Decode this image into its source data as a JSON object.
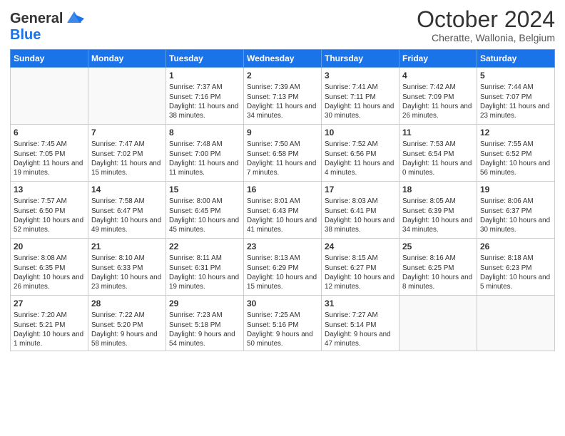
{
  "logo": {
    "line1": "General",
    "line2": "Blue"
  },
  "title": "October 2024",
  "subtitle": "Cheratte, Wallonia, Belgium",
  "weekdays": [
    "Sunday",
    "Monday",
    "Tuesday",
    "Wednesday",
    "Thursday",
    "Friday",
    "Saturday"
  ],
  "weeks": [
    [
      {
        "day": "",
        "info": ""
      },
      {
        "day": "",
        "info": ""
      },
      {
        "day": "1",
        "info": "Sunrise: 7:37 AM\nSunset: 7:16 PM\nDaylight: 11 hours and 38 minutes."
      },
      {
        "day": "2",
        "info": "Sunrise: 7:39 AM\nSunset: 7:13 PM\nDaylight: 11 hours and 34 minutes."
      },
      {
        "day": "3",
        "info": "Sunrise: 7:41 AM\nSunset: 7:11 PM\nDaylight: 11 hours and 30 minutes."
      },
      {
        "day": "4",
        "info": "Sunrise: 7:42 AM\nSunset: 7:09 PM\nDaylight: 11 hours and 26 minutes."
      },
      {
        "day": "5",
        "info": "Sunrise: 7:44 AM\nSunset: 7:07 PM\nDaylight: 11 hours and 23 minutes."
      }
    ],
    [
      {
        "day": "6",
        "info": "Sunrise: 7:45 AM\nSunset: 7:05 PM\nDaylight: 11 hours and 19 minutes."
      },
      {
        "day": "7",
        "info": "Sunrise: 7:47 AM\nSunset: 7:02 PM\nDaylight: 11 hours and 15 minutes."
      },
      {
        "day": "8",
        "info": "Sunrise: 7:48 AM\nSunset: 7:00 PM\nDaylight: 11 hours and 11 minutes."
      },
      {
        "day": "9",
        "info": "Sunrise: 7:50 AM\nSunset: 6:58 PM\nDaylight: 11 hours and 7 minutes."
      },
      {
        "day": "10",
        "info": "Sunrise: 7:52 AM\nSunset: 6:56 PM\nDaylight: 11 hours and 4 minutes."
      },
      {
        "day": "11",
        "info": "Sunrise: 7:53 AM\nSunset: 6:54 PM\nDaylight: 11 hours and 0 minutes."
      },
      {
        "day": "12",
        "info": "Sunrise: 7:55 AM\nSunset: 6:52 PM\nDaylight: 10 hours and 56 minutes."
      }
    ],
    [
      {
        "day": "13",
        "info": "Sunrise: 7:57 AM\nSunset: 6:50 PM\nDaylight: 10 hours and 52 minutes."
      },
      {
        "day": "14",
        "info": "Sunrise: 7:58 AM\nSunset: 6:47 PM\nDaylight: 10 hours and 49 minutes."
      },
      {
        "day": "15",
        "info": "Sunrise: 8:00 AM\nSunset: 6:45 PM\nDaylight: 10 hours and 45 minutes."
      },
      {
        "day": "16",
        "info": "Sunrise: 8:01 AM\nSunset: 6:43 PM\nDaylight: 10 hours and 41 minutes."
      },
      {
        "day": "17",
        "info": "Sunrise: 8:03 AM\nSunset: 6:41 PM\nDaylight: 10 hours and 38 minutes."
      },
      {
        "day": "18",
        "info": "Sunrise: 8:05 AM\nSunset: 6:39 PM\nDaylight: 10 hours and 34 minutes."
      },
      {
        "day": "19",
        "info": "Sunrise: 8:06 AM\nSunset: 6:37 PM\nDaylight: 10 hours and 30 minutes."
      }
    ],
    [
      {
        "day": "20",
        "info": "Sunrise: 8:08 AM\nSunset: 6:35 PM\nDaylight: 10 hours and 26 minutes."
      },
      {
        "day": "21",
        "info": "Sunrise: 8:10 AM\nSunset: 6:33 PM\nDaylight: 10 hours and 23 minutes."
      },
      {
        "day": "22",
        "info": "Sunrise: 8:11 AM\nSunset: 6:31 PM\nDaylight: 10 hours and 19 minutes."
      },
      {
        "day": "23",
        "info": "Sunrise: 8:13 AM\nSunset: 6:29 PM\nDaylight: 10 hours and 15 minutes."
      },
      {
        "day": "24",
        "info": "Sunrise: 8:15 AM\nSunset: 6:27 PM\nDaylight: 10 hours and 12 minutes."
      },
      {
        "day": "25",
        "info": "Sunrise: 8:16 AM\nSunset: 6:25 PM\nDaylight: 10 hours and 8 minutes."
      },
      {
        "day": "26",
        "info": "Sunrise: 8:18 AM\nSunset: 6:23 PM\nDaylight: 10 hours and 5 minutes."
      }
    ],
    [
      {
        "day": "27",
        "info": "Sunrise: 7:20 AM\nSunset: 5:21 PM\nDaylight: 10 hours and 1 minute."
      },
      {
        "day": "28",
        "info": "Sunrise: 7:22 AM\nSunset: 5:20 PM\nDaylight: 9 hours and 58 minutes."
      },
      {
        "day": "29",
        "info": "Sunrise: 7:23 AM\nSunset: 5:18 PM\nDaylight: 9 hours and 54 minutes."
      },
      {
        "day": "30",
        "info": "Sunrise: 7:25 AM\nSunset: 5:16 PM\nDaylight: 9 hours and 50 minutes."
      },
      {
        "day": "31",
        "info": "Sunrise: 7:27 AM\nSunset: 5:14 PM\nDaylight: 9 hours and 47 minutes."
      },
      {
        "day": "",
        "info": ""
      },
      {
        "day": "",
        "info": ""
      }
    ]
  ]
}
